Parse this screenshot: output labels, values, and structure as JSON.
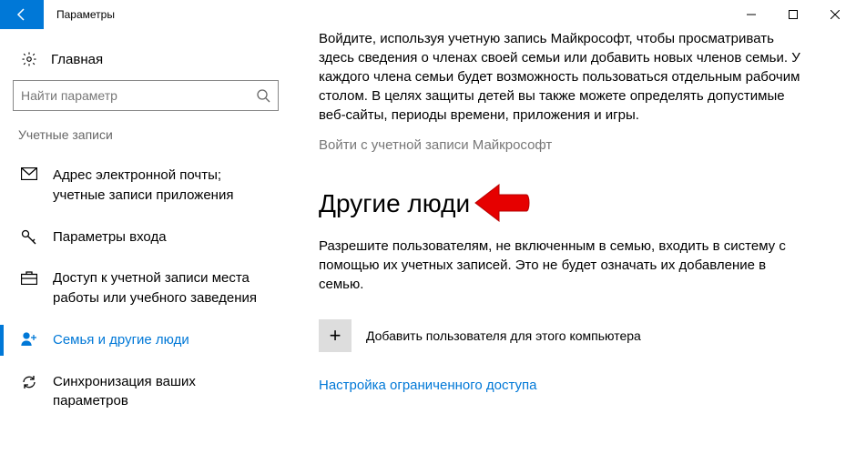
{
  "titlebar": {
    "title": "Параметры"
  },
  "sidebar": {
    "home": "Главная",
    "search_placeholder": "Найти параметр",
    "section": "Учетные записи",
    "items": [
      {
        "label": "Адрес электронной почты; учетные записи приложения"
      },
      {
        "label": "Параметры входа"
      },
      {
        "label": "Доступ к учетной записи места работы или учебного заведения"
      },
      {
        "label": "Семья и другие люди"
      },
      {
        "label": "Синхронизация ваших параметров"
      }
    ]
  },
  "main": {
    "intro": "Войдите, используя учетную запись Майкрософт, чтобы просматривать здесь сведения о членах своей семьи или добавить новых членов семьи. У каждого члена семьи будет возможность пользоваться отдельным рабочим столом. В целях защиты детей вы также можете определять допустимые веб-сайты, периоды времени, приложения и игры.",
    "signin": "Войти с учетной записи Майкрософт",
    "section_title": "Другие люди",
    "section_desc": "Разрешите пользователям, не включенным в семью, входить в систему с помощью их учетных записей. Это не будет означать их добавление в семью.",
    "add_user": "Добавить пользователя для этого компьютера",
    "kiosk": "Настройка ограниченного доступа"
  }
}
